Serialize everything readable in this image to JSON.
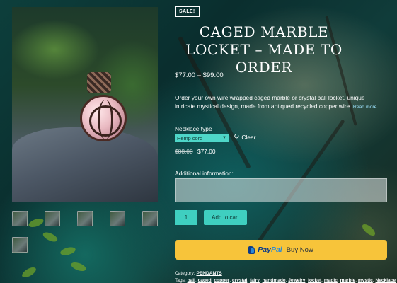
{
  "product": {
    "badge": "SALE!",
    "title": "CAGED MARBLE LOCKET – MADE TO ORDER",
    "price_range": "$77.00 – $99.00",
    "description": "Order your own wire wrapped caged marble or crystal ball locket, unique intricate mystical design, made from antiqued recycled copper wire.",
    "read_more": "Read more"
  },
  "variation": {
    "label": "Necklace type",
    "selected": "Hemp cord",
    "clear_label": "Clear",
    "old_price": "$88.00",
    "new_price": "$77.00"
  },
  "additional": {
    "label": "Additional information:"
  },
  "cart": {
    "quantity": "1",
    "add_to_cart": "Add to cart"
  },
  "paypal": {
    "pay": "Pay",
    "pal": "Pal",
    "buy_now": "Buy Now"
  },
  "meta": {
    "category_label": "Category:",
    "category": "PENDANTS",
    "tags_label": "Tags:",
    "tags": [
      "ball",
      "caged",
      "copper",
      "crystal",
      "fairy",
      "handmade",
      "Jewelry",
      "locket",
      "magic",
      "marble",
      "mystic",
      "Necklace"
    ]
  },
  "colors": {
    "accent": "#3fcfc0",
    "paypal_button": "#f7c43a",
    "paypal_dark": "#0d3b88",
    "paypal_light": "#2a8ad8"
  },
  "icons": {
    "clear": "refresh-icon",
    "dropdown": "chevron-down-icon"
  }
}
